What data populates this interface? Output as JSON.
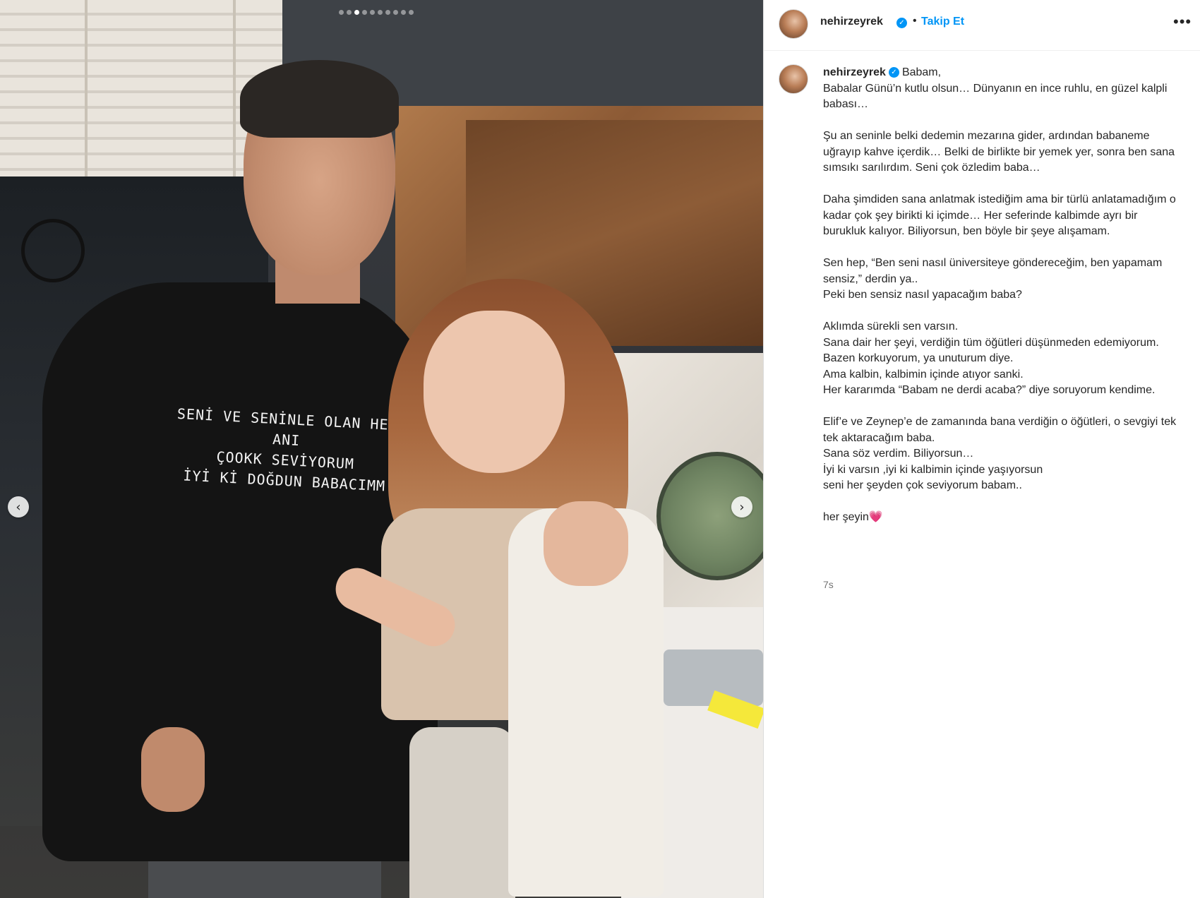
{
  "post": {
    "username": "nehirzeyrek",
    "follow_label": "Takip Et",
    "separator": "•",
    "more_label": "•••",
    "caption_first": "Babam,",
    "caption_body": "Babalar Günü’n kutlu olsun… Dünyanın en ince ruhlu, en güzel kalpli babası…\n\nŞu an seninle belki dedemin mezarına gider, ardından babaneme uğrayıp kahve içerdik… Belki de birlikte bir yemek yer, sonra ben sana sımsıkı sarılırdım. Seni çok özledim baba…\n\nDaha şimdiden sana anlatmak istediğim ama bir türlü anlatamadığım o kadar çok şey birikti ki içimde… Her seferinde kalbimde ayrı bir burukluk kalıyor. Biliyorsun, ben böyle bir şeye alışamam.\n\nSen hep, “Ben seni nasıl üniversiteye göndereceğim, ben yapamam sensiz,” derdin ya..\nPeki ben sensiz nasıl yapacağım baba?\n\nAklımda sürekli sen varsın.\nSana dair her şeyi, verdiğin tüm öğütleri düşünmeden edemiyorum.\nBazen korkuyorum, ya unuturum diye.\nAma kalbin, kalbimin içinde atıyor sanki.\nHer kararımda “Babam ne derdi acaba?” diye soruyorum kendime.\n\nElif’e ve Zeynep’e de zamanında bana verdiğin o öğütleri, o sevgiyi tek tek aktaracağım baba.\nSana söz verdim. Biliyorsun…\nİyi ki varsın ,iyi ki kalbimin içinde yaşıyorsun\nseni her şeyden çok seviyorum babam..\n\nher şeyin💗",
    "timestamp": "7s"
  },
  "media": {
    "shirt_text_line1": "SENİ VE SENİNLE OLAN HER ANI",
    "shirt_text_line2": "ÇOOKK SEVİYORUM",
    "shirt_text_line3": "İYİ Kİ DOĞDUN BABACIMM",
    "carousel": {
      "count": 10,
      "active_index": 2
    },
    "prev_icon": "‹",
    "next_icon": "›"
  },
  "icons": {
    "verified": "✓"
  },
  "colors": {
    "accent": "#0095f6",
    "text": "#262626",
    "muted": "#737373"
  }
}
